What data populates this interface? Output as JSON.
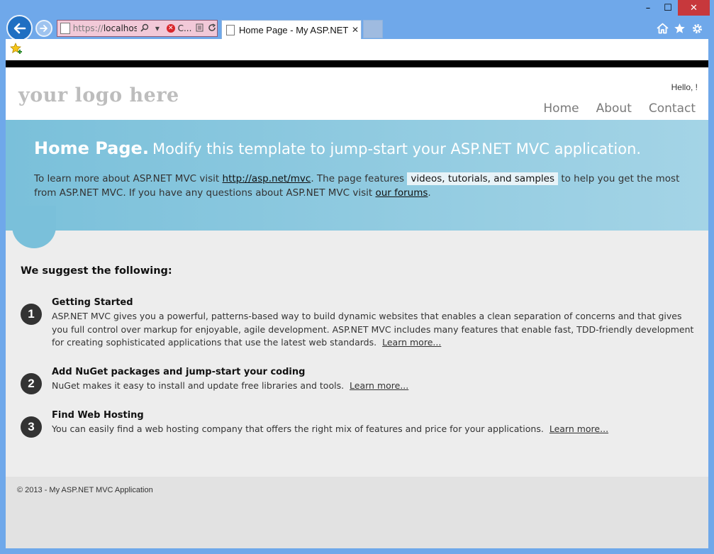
{
  "browser": {
    "address": {
      "protocol": "https://",
      "host": "localhost",
      "short_label": "C..."
    },
    "tab_title": "Home Page - My ASP.NET ...",
    "new_tab_label": "",
    "window_controls": {
      "minimize": "–",
      "maximize": "☐",
      "close": "✕"
    },
    "toolbar_icons": [
      "home-icon",
      "favorites-star-icon",
      "settings-gear-icon"
    ],
    "colors": {
      "frame": "#6fa8ea",
      "close": "#c7383c",
      "address_bg": "#f2c9d8"
    }
  },
  "site": {
    "logo": "your logo here",
    "greeting": "Hello, !",
    "nav": [
      "Home",
      "About",
      "Contact"
    ]
  },
  "hero": {
    "title_bold": "Home Page.",
    "title_rest": "Modify this template to jump-start your ASP.NET MVC application.",
    "text_1": "To learn more about ASP.NET MVC visit",
    "link_1": "http://asp.net/mvc",
    "text_2": ". The page features",
    "highlight": "videos, tutorials, and samples",
    "text_3": "to help you get the most from ASP.NET MVC. If you have any questions about ASP.NET MVC visit",
    "link_2": "our forums",
    "text_4": "."
  },
  "suggest_heading": "We suggest the following:",
  "steps": [
    {
      "number": "1",
      "title": "Getting Started",
      "body": "ASP.NET MVC gives you a powerful, patterns-based way to build dynamic websites that enables a clean separation of concerns and that gives you full control over markup for enjoyable, agile development. ASP.NET MVC includes many features that enable fast, TDD-friendly development for creating sophisticated applications that use the latest web standards.",
      "link": "Learn more..."
    },
    {
      "number": "2",
      "title": "Add NuGet packages and jump-start your coding",
      "body": "NuGet makes it easy to install and update free libraries and tools.",
      "link": "Learn more..."
    },
    {
      "number": "3",
      "title": "Find Web Hosting",
      "body": "You can easily find a web hosting company that offers the right mix of features and price for your applications.",
      "link": "Learn more..."
    }
  ],
  "footer": {
    "copyright": "© 2013 - My ASP.NET MVC Application"
  }
}
